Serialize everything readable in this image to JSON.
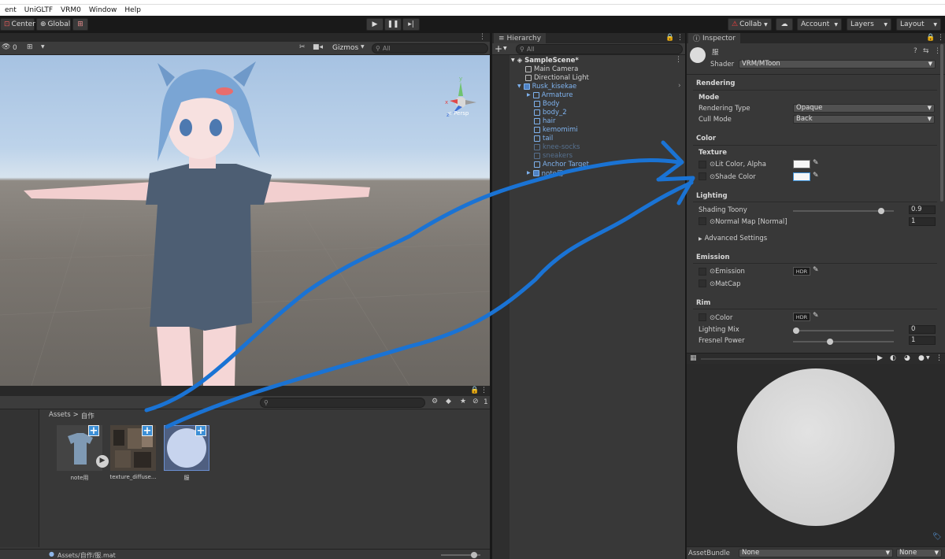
{
  "menu": {
    "items": [
      "ent",
      "UniGLTF",
      "VRM0",
      "Window",
      "Help"
    ]
  },
  "toolbar": {
    "pivot_center": "Center",
    "pivot_global": "Global",
    "collab": "Collab",
    "account": "Account",
    "layers": "Layers",
    "layout": "Layout"
  },
  "scene": {
    "hidden_count": "0",
    "gizmos": "Gizmos",
    "search_placeholder": "All",
    "persp_label": "< Persp"
  },
  "hierarchy": {
    "tab": "Hierarchy",
    "search_placeholder": "All",
    "scene_name": "SampleScene*",
    "items": [
      {
        "label": "Main Camera",
        "color": "#d2d2d2"
      },
      {
        "label": "Directional Light",
        "color": "#d2d2d2"
      },
      {
        "label": "Rusk_kisekae",
        "color": "#7fb3ef"
      },
      {
        "label": "Armature",
        "color": "#7fb3ef"
      },
      {
        "label": "Body",
        "color": "#7fb3ef"
      },
      {
        "label": "body_2",
        "color": "#7fb3ef"
      },
      {
        "label": "hair",
        "color": "#7fb3ef"
      },
      {
        "label": "kemomimi",
        "color": "#7fb3ef"
      },
      {
        "label": "tail",
        "color": "#7fb3ef"
      },
      {
        "label": "knee-socks",
        "color": "#56708f"
      },
      {
        "label": "sneakers",
        "color": "#56708f"
      },
      {
        "label": "Anchor Target",
        "color": "#7fb3ef"
      },
      {
        "label": "note用",
        "color": "#7fb3ef"
      }
    ]
  },
  "project": {
    "breadcrumb_root": "Assets",
    "breadcrumb_sep": ">",
    "breadcrumb_folder": "自作",
    "hidden_count": "1",
    "assets": [
      {
        "label": "note用"
      },
      {
        "label": "texture_diffuse..."
      },
      {
        "label": "服"
      }
    ],
    "status_path": "Assets/自作/服.mat"
  },
  "inspector": {
    "tab": "Inspector",
    "material_name": "服",
    "shader_label": "Shader",
    "shader_value": "VRM/MToon",
    "rendering": {
      "title": "Rendering",
      "mode_title": "Mode",
      "rendering_type_label": "Rendering Type",
      "rendering_type_value": "Opaque",
      "cull_mode_label": "Cull Mode",
      "cull_mode_value": "Back"
    },
    "color": {
      "title": "Color",
      "texture_title": "Texture",
      "lit_color_label": "Lit Color, Alpha",
      "shade_color_label": "Shade Color"
    },
    "lighting": {
      "title": "Lighting",
      "shading_toony_label": "Shading Toony",
      "shading_toony_value": "0.9",
      "shading_toony_level": 0.9,
      "normal_map_label": "Normal Map [Normal]",
      "normal_map_value": "1",
      "advanced_label": "Advanced Settings"
    },
    "emission": {
      "title": "Emission",
      "emission_label": "Emission",
      "hdr": "HDR",
      "matcap_label": "MatCap"
    },
    "rim": {
      "title": "Rim",
      "color_label": "Color",
      "hdr": "HDR",
      "lighting_mix_label": "Lighting Mix",
      "lighting_mix_value": "0",
      "lighting_mix_level": 0,
      "fresnel_label": "Fresnel Power",
      "fresnel_value": "1",
      "fresnel_level": 0.36
    },
    "asset_bundle_label": "AssetBundle",
    "asset_bundle_value": "None",
    "asset_bundle_variant": "None"
  },
  "colors": {
    "annotation_stroke": "#1a73d4",
    "selection_blue": "#3c8fd6",
    "panel_bg": "#383838"
  }
}
